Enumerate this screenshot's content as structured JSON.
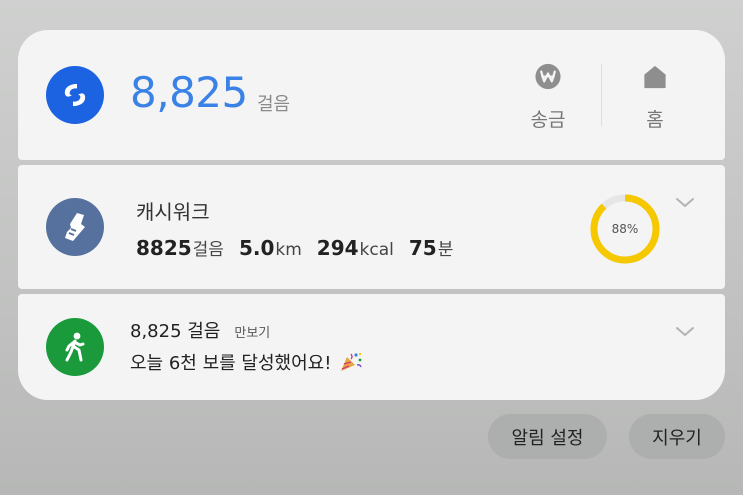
{
  "top_card": {
    "steps": "8,825",
    "unit": "걸음",
    "send_label": "송금",
    "home_label": "홈"
  },
  "cashwalk": {
    "title": "캐시워크",
    "steps_value": "8825",
    "steps_unit": "걸음",
    "distance_value": "5.0",
    "distance_unit": "km",
    "calories_value": "294",
    "calories_unit": "kcal",
    "time_value": "75",
    "time_unit": "분",
    "progress_text": "88%",
    "progress": 0.88
  },
  "notification": {
    "title": "8,825 걸음",
    "app": "만보기",
    "message": "오늘 6천 보를 달성했어요!"
  },
  "buttons": {
    "notification_settings": "알림 설정",
    "clear": "지우기"
  },
  "colors": {
    "toss_blue": "#1c63e2",
    "steps_blue": "#3b82e6",
    "cashwalk_slate": "#56719e",
    "pedometer_green": "#1b9a3c",
    "progress_yellow": "#f5c800",
    "progress_track": "#e6e6e6"
  },
  "icons": {
    "app_logo": "swirl-logo-icon",
    "send": "won-coin-icon",
    "home": "home-icon",
    "cashwalk": "shoe-icon",
    "pedometer": "walking-person-icon",
    "expand": "chevron-down-icon",
    "party": "party-popper-icon"
  }
}
